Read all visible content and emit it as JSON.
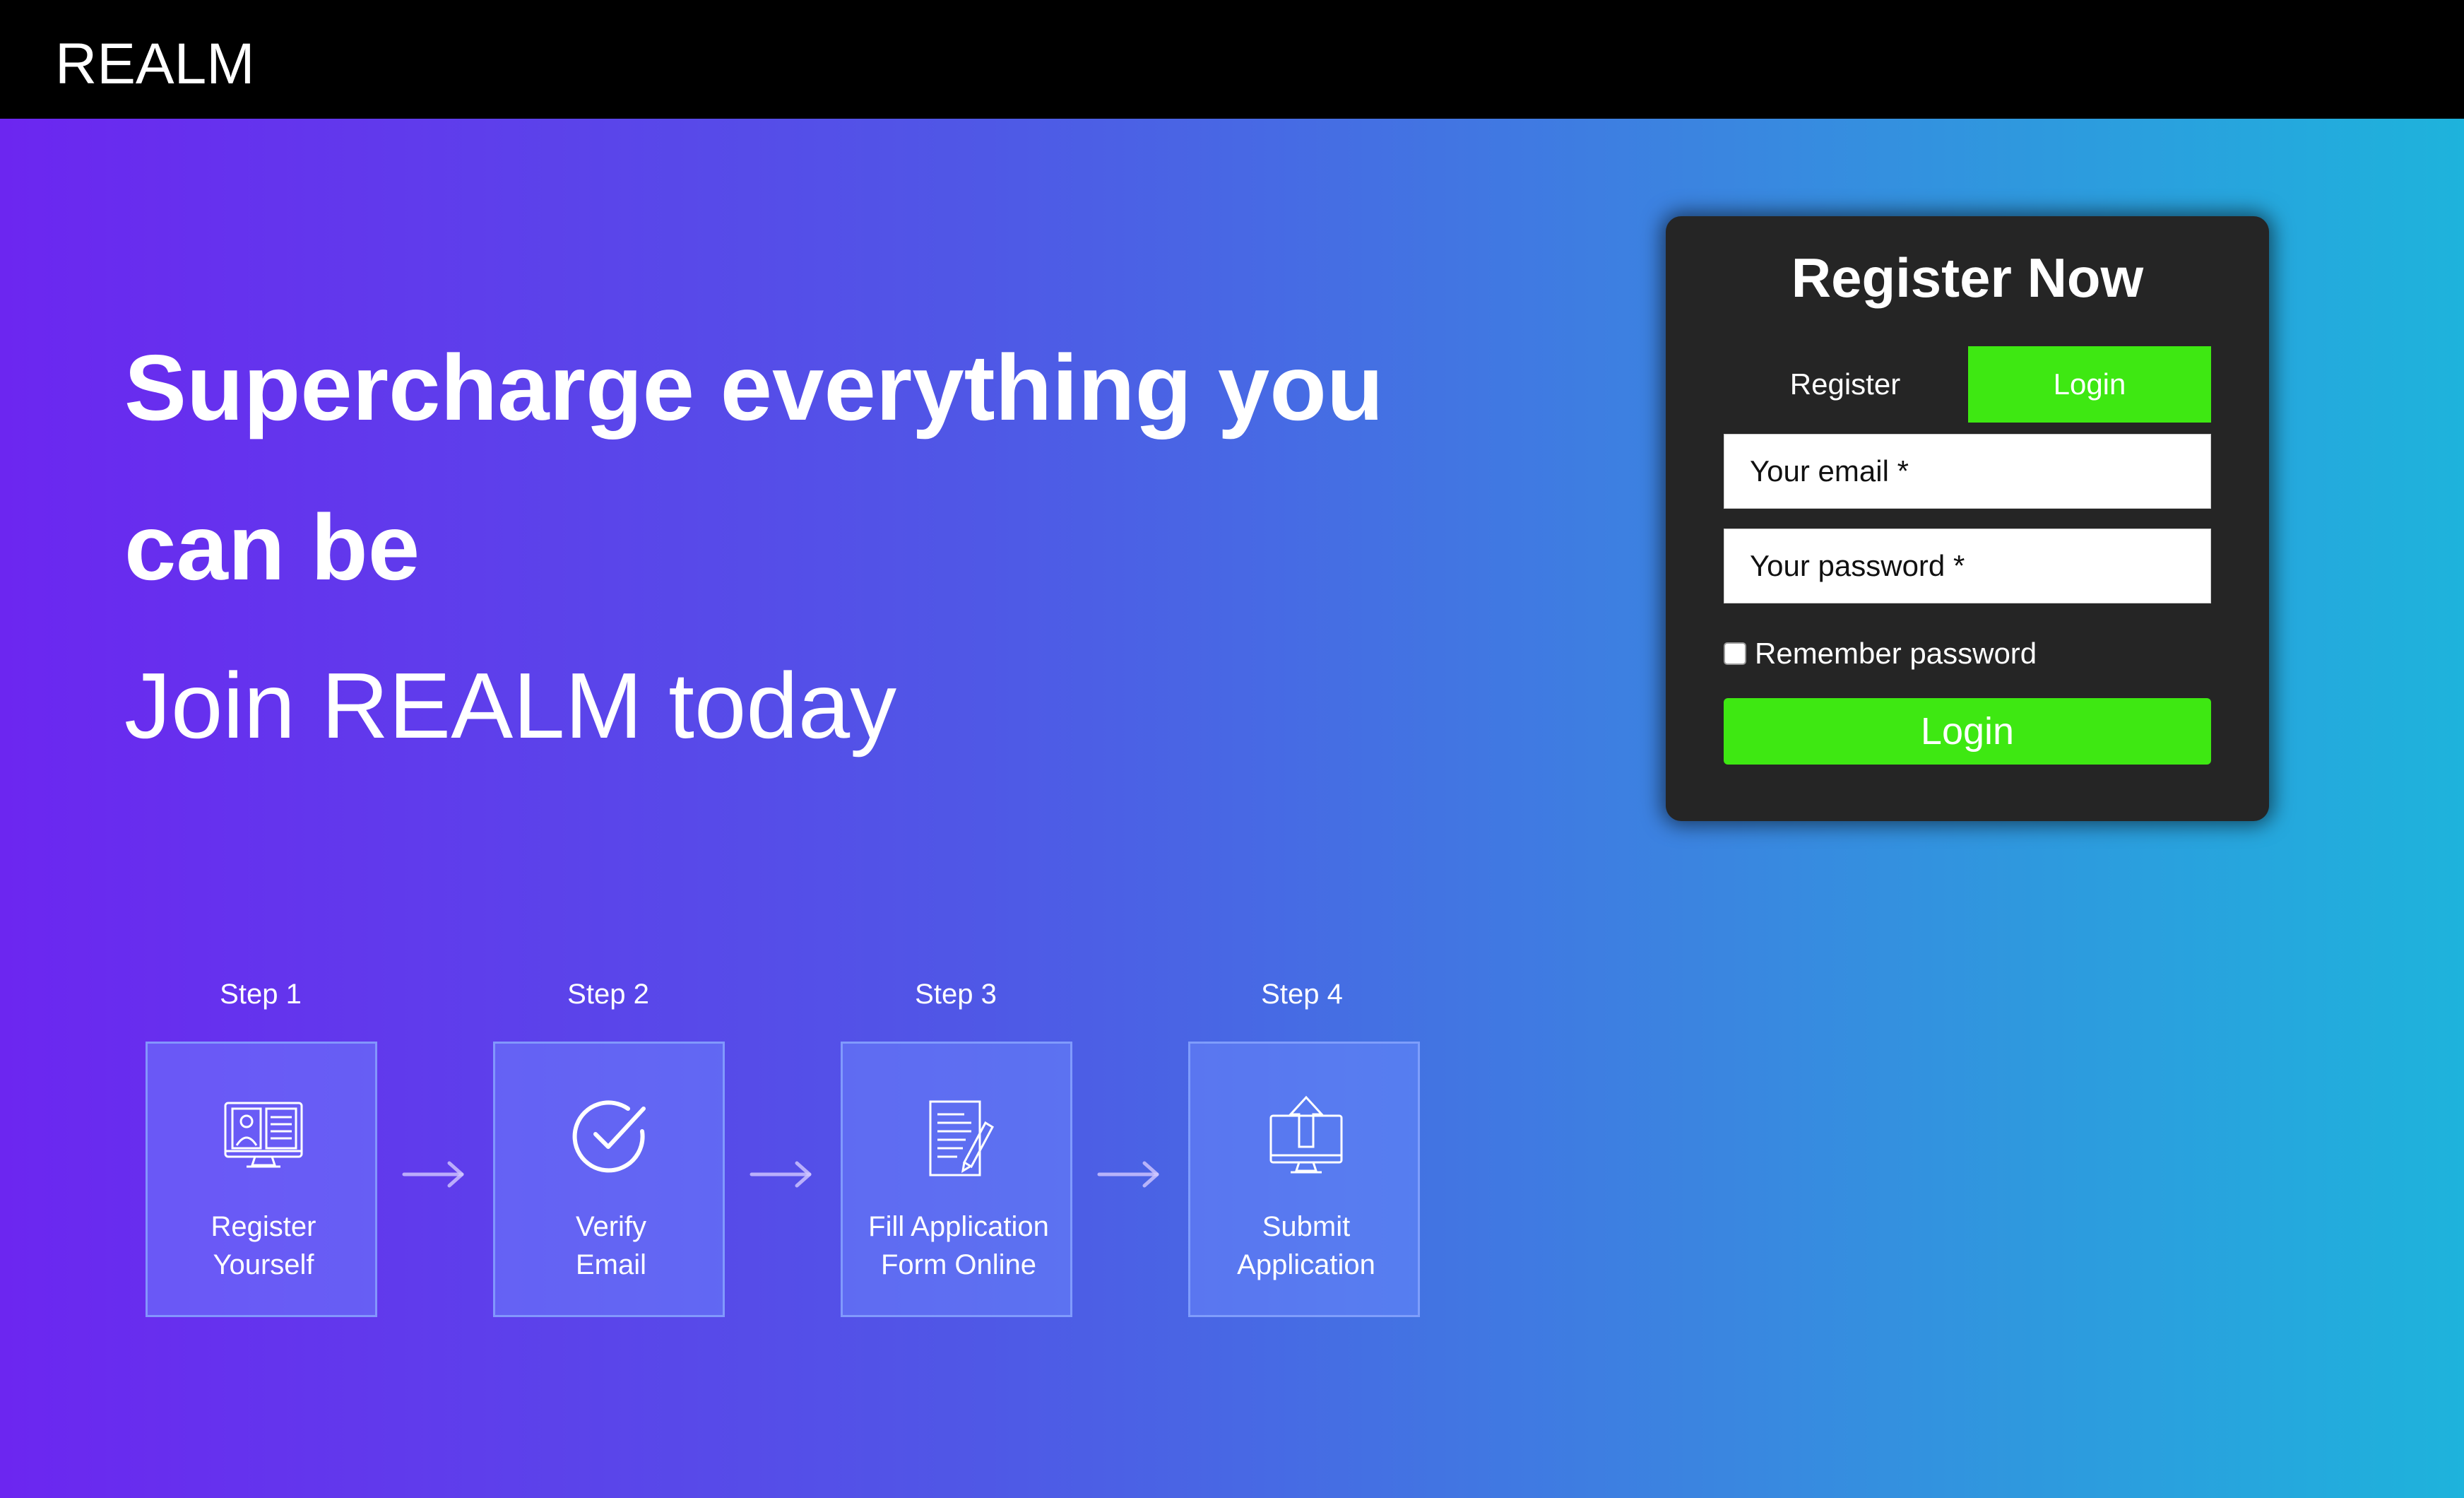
{
  "header": {
    "logo": "REALM"
  },
  "hero": {
    "line1": "Supercharge everything you",
    "line2": "can be",
    "line3": "Join REALM today"
  },
  "panel": {
    "title": "Register Now",
    "tabs": {
      "register": "Register",
      "login": "Login"
    },
    "active_tab": "Login",
    "email_placeholder": "Your email *",
    "password_placeholder": "Your password *",
    "remember_label": "Remember password",
    "remember_checked": false,
    "submit_label": "Login"
  },
  "steps": [
    {
      "label": "Step 1",
      "line1": "Register",
      "line2": "Yourself",
      "icon": "monitor-profile-icon"
    },
    {
      "label": "Step 2",
      "line1": "Verify",
      "line2": "Email",
      "icon": "check-circle-icon"
    },
    {
      "label": "Step 3",
      "line1": "Fill Application",
      "line2": "Form Online",
      "icon": "document-pen-icon"
    },
    {
      "label": "Step 4",
      "line1": "Submit",
      "line2": "Application",
      "icon": "monitor-upload-icon"
    }
  ],
  "colors": {
    "accent_green": "#3ee812",
    "panel_bg": "#252525",
    "gradient_start": "#6c26f0",
    "gradient_end": "#1eb3dc"
  }
}
